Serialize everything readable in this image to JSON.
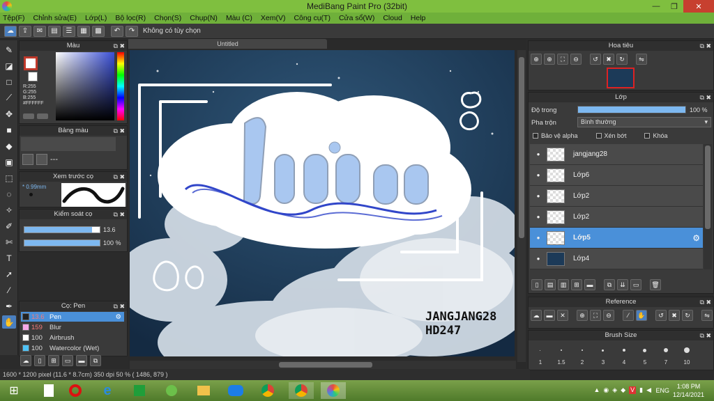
{
  "window": {
    "title": "MediBang Paint Pro (32bit)",
    "minimize": "—",
    "maximize": "❐",
    "close": "✕"
  },
  "menu": [
    "Tệp(F)",
    "Chỉnh sửa(E)",
    "Lớp(L)",
    "Bộ lọc(R)",
    "Chọn(S)",
    "Chụp(N)",
    "Màu (C)",
    "Xem(V)",
    "Công cụ(T)",
    "Cửa sổ(W)",
    "Cloud",
    "Help"
  ],
  "toolbar": {
    "selection_hint": "Không có tùy chọn"
  },
  "canvas": {
    "tab_title": "Untitled",
    "text_watermark_line1": "JANGJANG28",
    "text_watermark_line2": "HD247",
    "art_text": "Lin"
  },
  "color_panel": {
    "title": "Màu",
    "r": "R:255",
    "g": "G:255",
    "b": "B:255",
    "hex": "#FFFFFF"
  },
  "palette_panel": {
    "title": "Bảng màu",
    "dash": "---"
  },
  "brush_preview": {
    "title": "Xem trước cọ",
    "size": "* 0.99mm"
  },
  "brush_control": {
    "title": "Kiểm soát cọ",
    "size_value": "13.6",
    "opacity_value": "100 %",
    "size_fraction": 0.9,
    "opacity_fraction": 1.0
  },
  "brush_list": {
    "title": "Cọ: Pen",
    "items": [
      {
        "size": "13.6",
        "name": "Pen",
        "color": "#222222"
      },
      {
        "size": "159",
        "name": "Blur",
        "color": "#f7a8e8"
      },
      {
        "size": "100",
        "name": "Airbrush",
        "color": "#ffffff"
      },
      {
        "size": "100",
        "name": "Watercolor (Wet)",
        "color": "#4fc3f7"
      }
    ]
  },
  "navigator": {
    "title": "Hoa tiêu"
  },
  "layer_panel": {
    "title": "Lớp",
    "opacity_label": "Độ trong",
    "opacity_value": "100 %",
    "opacity_fraction": 1.0,
    "blend_label": "Pha trộn",
    "blend_value": "Bình thường",
    "protect_alpha": "Bảo vệ alpha",
    "clipping": "Xén bớt",
    "lock": "Khóa",
    "layers": [
      {
        "name": "jangjang28"
      },
      {
        "name": "Lớp6"
      },
      {
        "name": "Lớp2"
      },
      {
        "name": "Lớp2"
      },
      {
        "name": "Lớp5"
      },
      {
        "name": "Lớp4"
      }
    ]
  },
  "reference_panel": {
    "title": "Reference"
  },
  "brush_size_panel": {
    "title": "Brush Size",
    "sizes": [
      "1",
      "1.5",
      "2",
      "3",
      "4",
      "5",
      "7",
      "10"
    ]
  },
  "statusbar": {
    "text": "1600 * 1200 pixel  (11.6 * 8.7cm)  350 dpi  50 %  ( 1486, 879 )"
  },
  "taskbar": {
    "lang": "ENG",
    "time": "1:08 PM",
    "date": "12/14/2021"
  }
}
